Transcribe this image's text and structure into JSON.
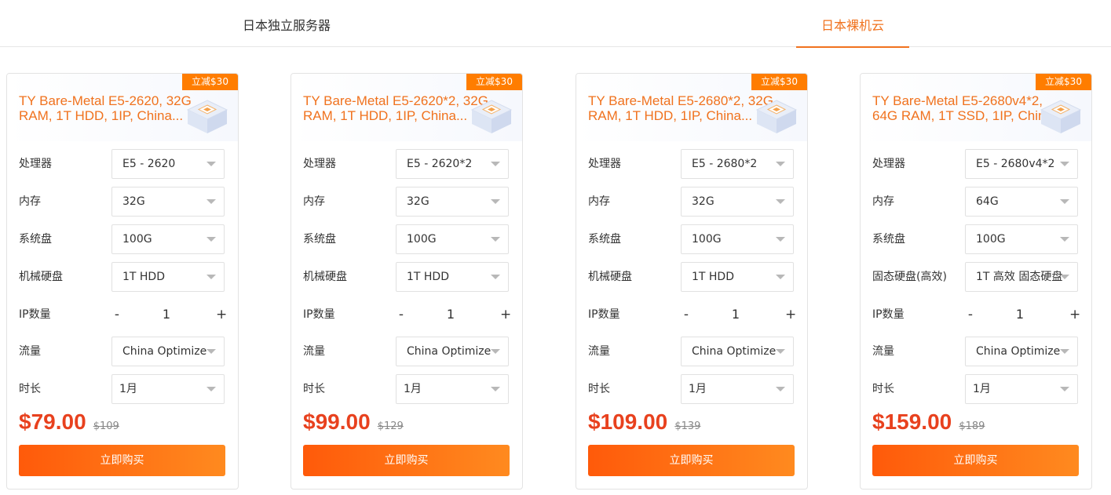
{
  "tabs": {
    "dedicated": "日本独立服务器",
    "baremetal": "日本裸机云"
  },
  "colors": {
    "accent": "#f0721e",
    "price": "#e8411e",
    "badge": "#ff7d00"
  },
  "labels": {
    "cpu": "处理器",
    "ram": "内存",
    "system_disk": "系统盘",
    "ip_count": "IP数量",
    "traffic": "流量",
    "duration": "时长",
    "buy": "立即购买",
    "minus": "-",
    "plus": "+"
  },
  "cards": [
    {
      "title": "TY Bare-Metal E5-2620, 32G RAM, 1T HDD, 1IP, China...",
      "badge": "立减$30",
      "cpu": "E5 - 2620",
      "ram": "32G",
      "system_disk": "100G",
      "disk_label": "机械硬盘",
      "disk": "1T HDD",
      "ip_qty": "1",
      "traffic": "China Optimize",
      "duration": "1月",
      "price": "$79.00",
      "old_price": "$109"
    },
    {
      "title": "TY Bare-Metal E5-2620*2, 32G RAM, 1T HDD, 1IP, China...",
      "badge": "立减$30",
      "cpu": "E5 - 2620*2",
      "ram": "32G",
      "system_disk": "100G",
      "disk_label": "机械硬盘",
      "disk": "1T HDD",
      "ip_qty": "1",
      "traffic": "China Optimize",
      "duration": "1月",
      "price": "$99.00",
      "old_price": "$129"
    },
    {
      "title": "TY Bare-Metal E5-2680*2, 32G RAM, 1T HDD, 1IP, China...",
      "badge": "立减$30",
      "cpu": "E5 - 2680*2",
      "ram": "32G",
      "system_disk": "100G",
      "disk_label": "机械硬盘",
      "disk": "1T HDD",
      "ip_qty": "1",
      "traffic": "China Optimize",
      "duration": "1月",
      "price": "$109.00",
      "old_price": "$139"
    },
    {
      "title": "TY Bare-Metal E5-2680v4*2, 64G RAM, 1T SSD, 1IP, China...",
      "badge": "立减$30",
      "cpu": "E5 - 2680v4*2",
      "ram": "64G",
      "system_disk": "100G",
      "disk_label": "固态硬盘(高效)",
      "disk": "1T 高效 固态硬盘",
      "ip_qty": "1",
      "traffic": "China Optimize",
      "duration": "1月",
      "price": "$159.00",
      "old_price": "$189"
    }
  ]
}
